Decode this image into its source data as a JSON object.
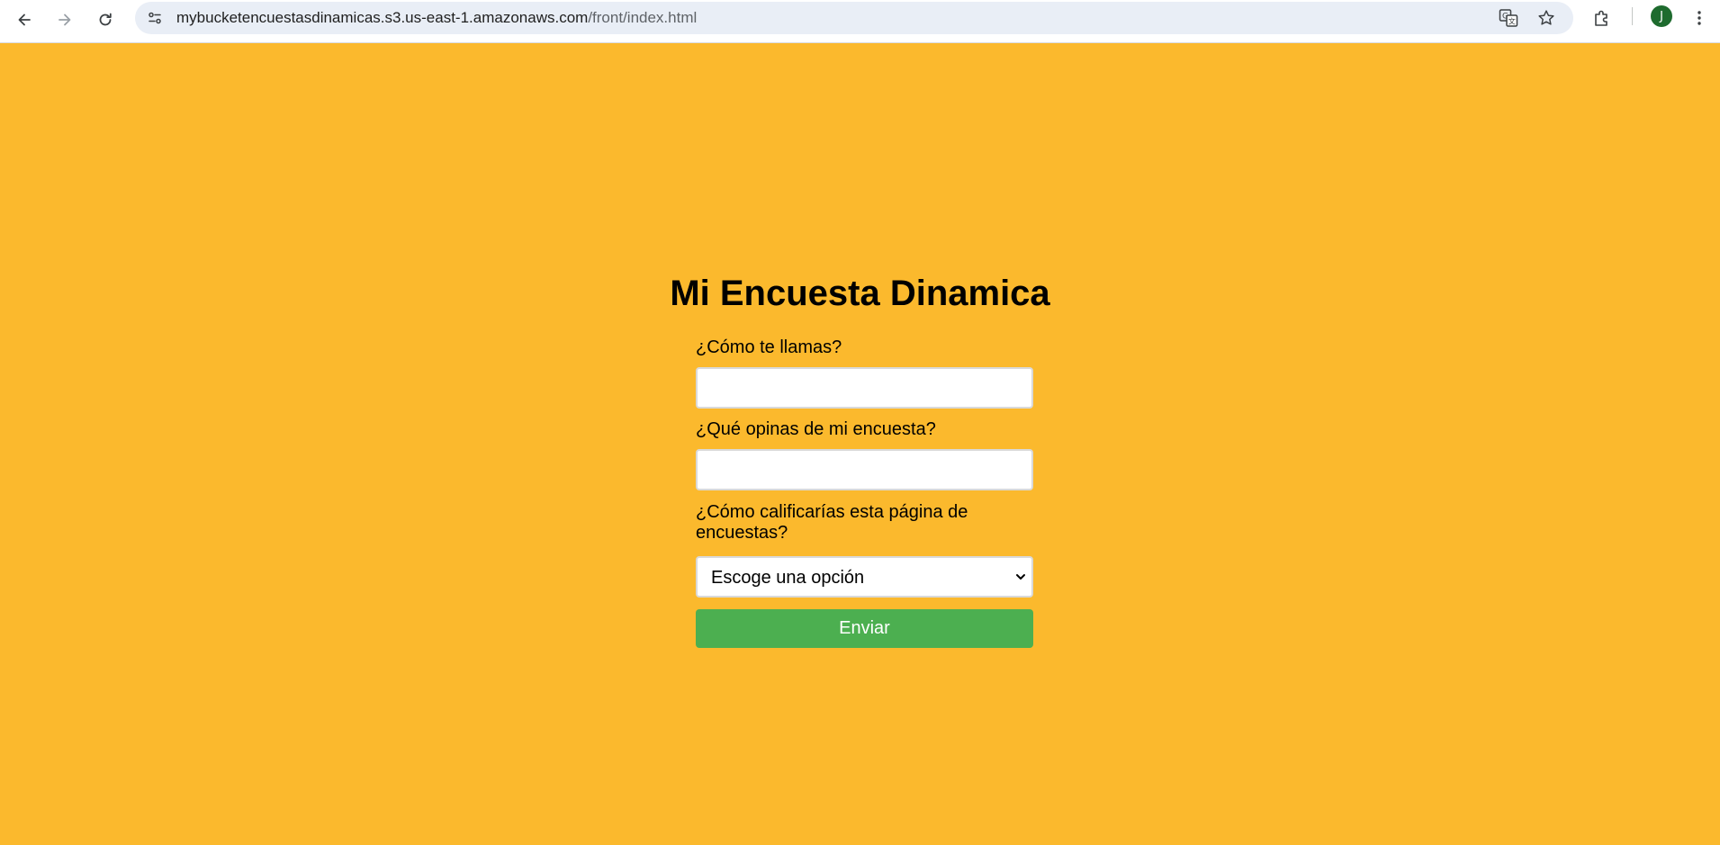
{
  "browser": {
    "url_host": "mybucketencuestasdinamicas.s3.us-east-1.amazonaws.com",
    "url_path": "/front/index.html",
    "avatar_initial": "J",
    "icons": [
      "back-icon",
      "forward-icon",
      "reload-icon",
      "site-info-icon",
      "translate-icon",
      "star-icon",
      "extensions-icon",
      "menu-icon"
    ]
  },
  "page": {
    "title": "Mi Encuesta Dinamica",
    "background_color": "#fbb92d",
    "form": {
      "name_label": "¿Cómo te llamas?",
      "name_value": "",
      "opinion_label": "¿Qué opinas de mi encuesta?",
      "opinion_value": "",
      "rating_label": "¿Cómo calificarías esta página de encuestas?",
      "rating_selected": "Escoge una opción",
      "submit_label": "Enviar",
      "submit_color": "#4caf50"
    }
  }
}
